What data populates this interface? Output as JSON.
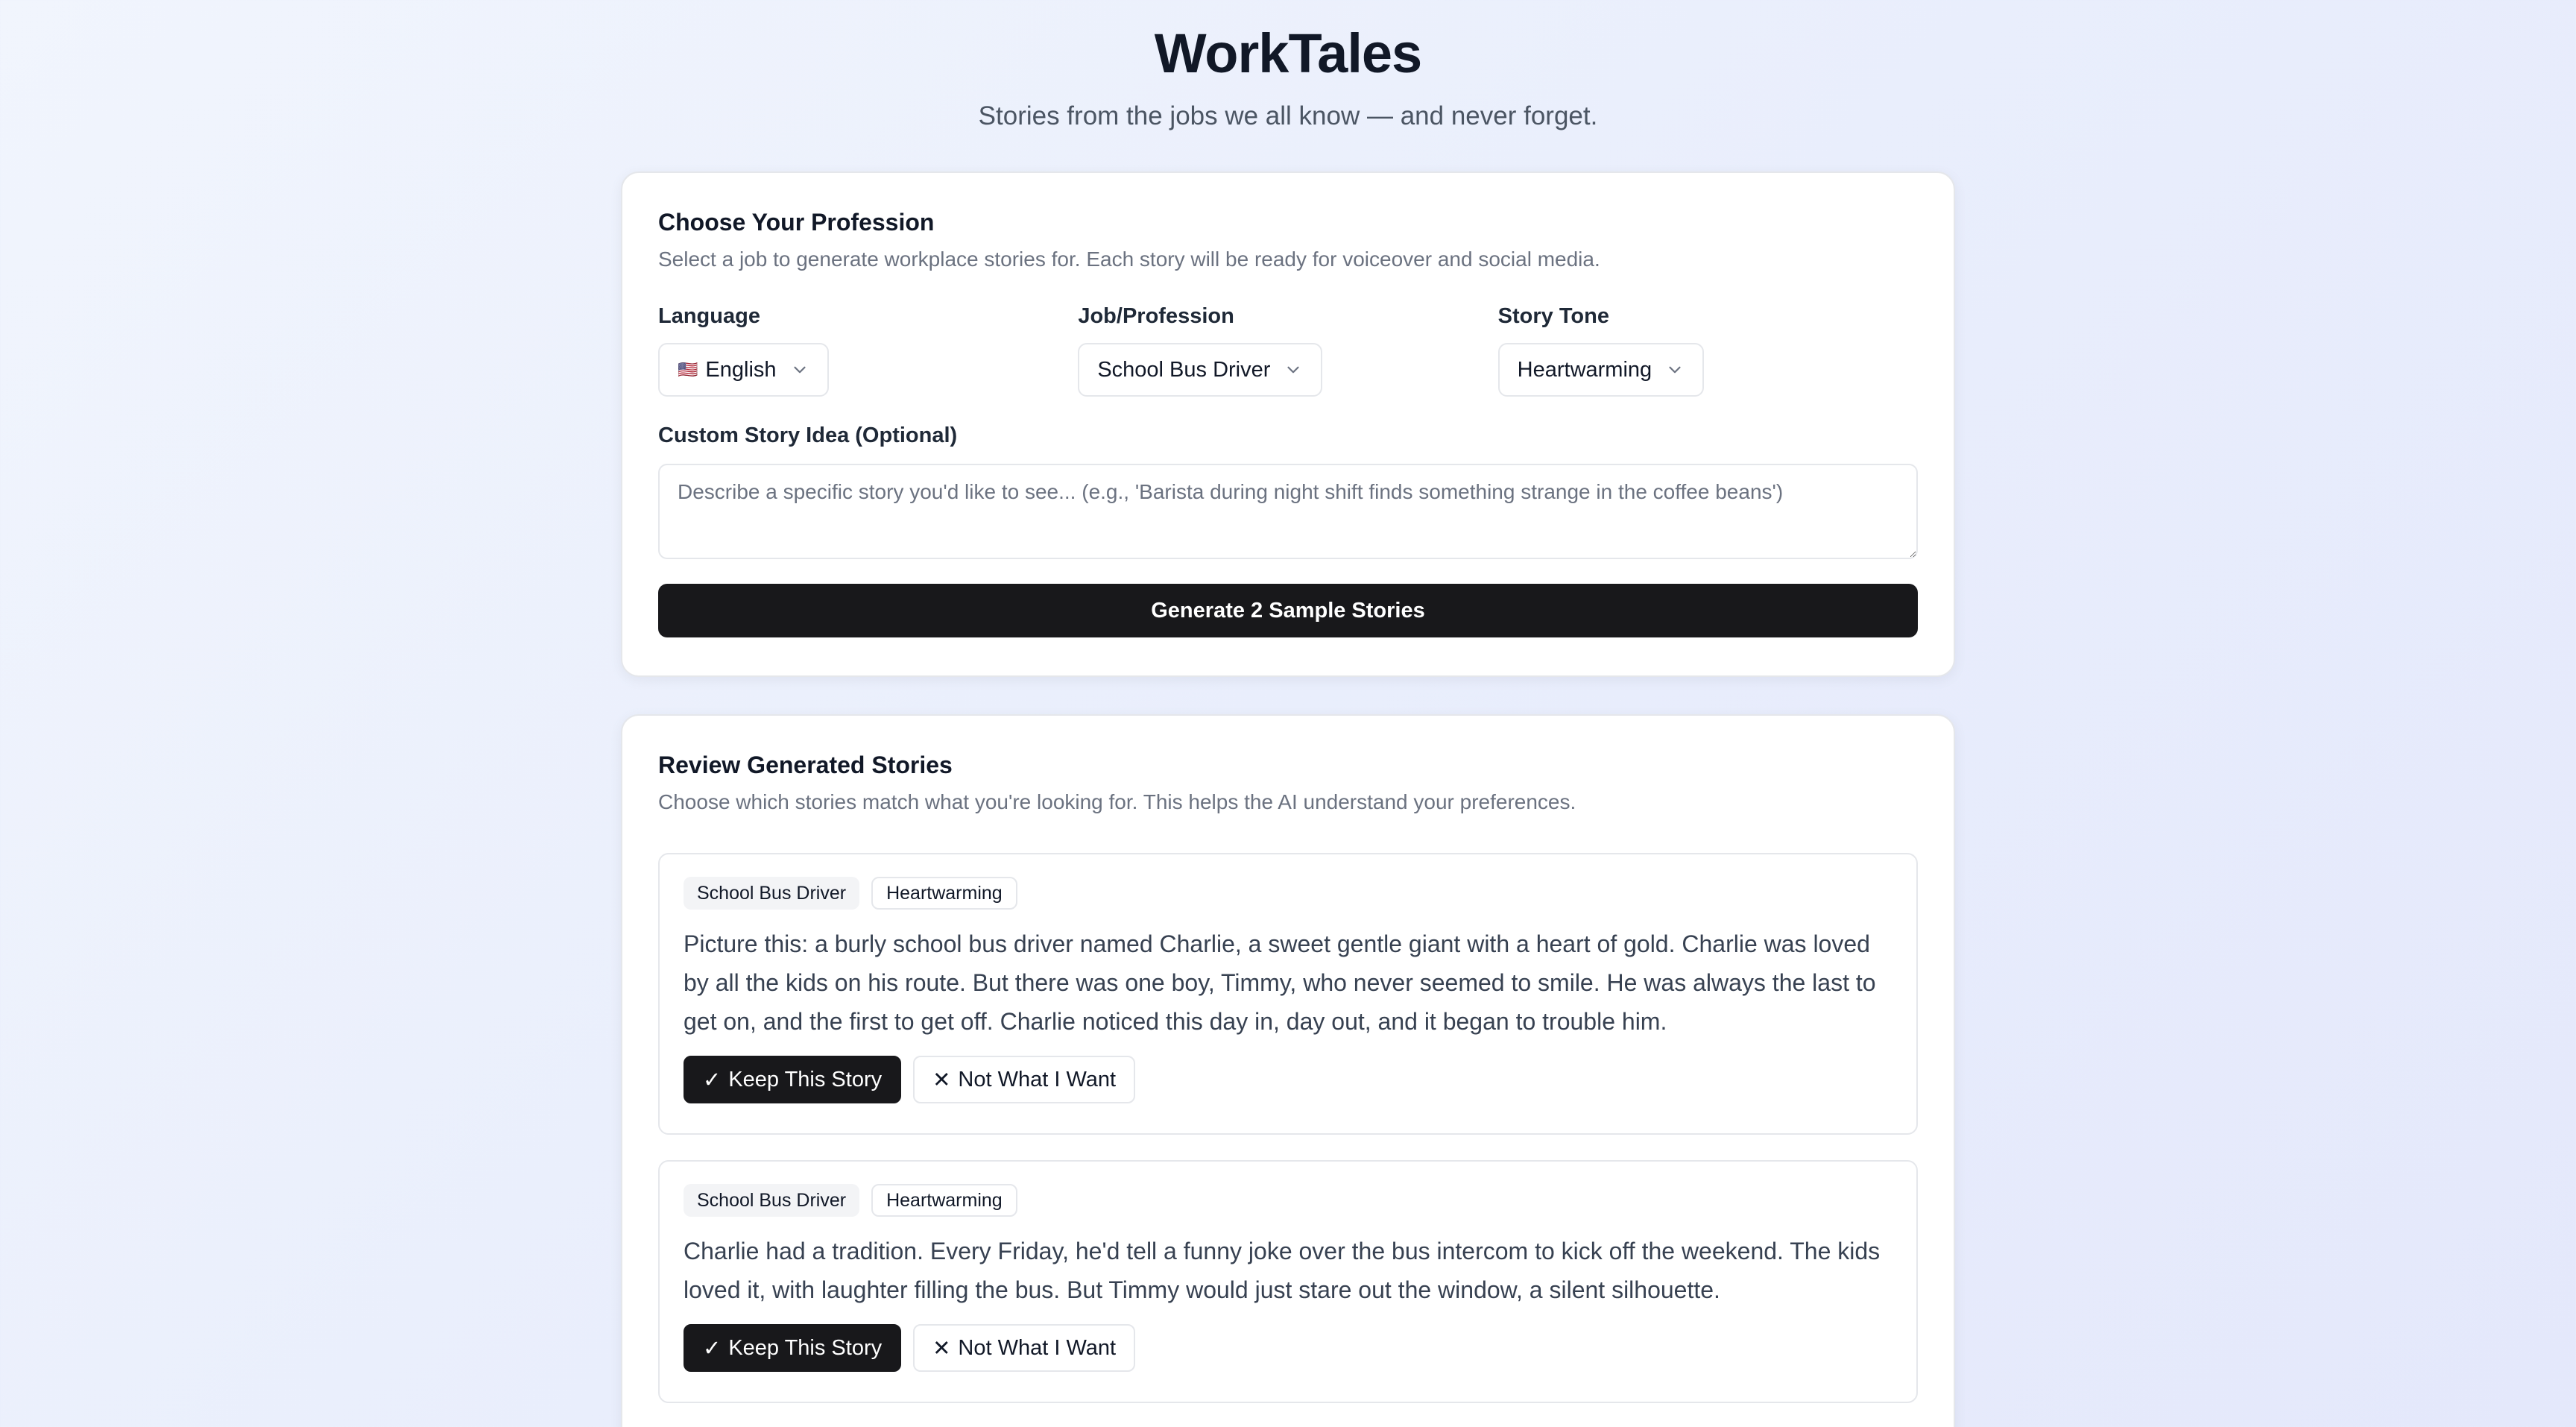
{
  "header": {
    "title": "WorkTales",
    "subtitle": "Stories from the jobs we all know — and never forget."
  },
  "profession_card": {
    "title": "Choose Your Profession",
    "description": "Select a job to generate workplace stories for. Each story will be ready for voiceover and social media.",
    "language": {
      "label": "Language",
      "flag": "🇺🇸",
      "value": "English"
    },
    "job": {
      "label": "Job/Profession",
      "value": "School Bus Driver"
    },
    "tone": {
      "label": "Story Tone",
      "value": "Heartwarming"
    },
    "custom": {
      "label": "Custom Story Idea (Optional)",
      "placeholder": "Describe a specific story you'd like to see... (e.g., 'Barista during night shift finds something strange in the coffee beans')",
      "value": ""
    },
    "generate_label": "Generate 2 Sample Stories"
  },
  "review_card": {
    "title": "Review Generated Stories",
    "description": "Choose which stories match what you're looking for. This helps the AI understand your preferences.",
    "stories": [
      {
        "job_tag": "School Bus Driver",
        "tone_tag": "Heartwarming",
        "text": "Picture this: a burly school bus driver named Charlie, a sweet gentle giant with a heart of gold. Charlie was loved by all the kids on his route. But there was one boy, Timmy, who never seemed to smile. He was always the last to get on, and the first to get off. Charlie noticed this day in, day out, and it began to trouble him.",
        "keep_label": "Keep This Story",
        "reject_label": "Not What I Want"
      },
      {
        "job_tag": "School Bus Driver",
        "tone_tag": "Heartwarming",
        "text": "Charlie had a tradition. Every Friday, he'd tell a funny joke over the bus intercom to kick off the weekend. The kids loved it, with laughter filling the bus. But Timmy would just stare out the window, a silent silhouette.",
        "keep_label": "Keep This Story",
        "reject_label": "Not What I Want"
      }
    ]
  },
  "icons": {
    "check": "✓",
    "cross": "✕",
    "chevron": "chevron-down-icon"
  }
}
